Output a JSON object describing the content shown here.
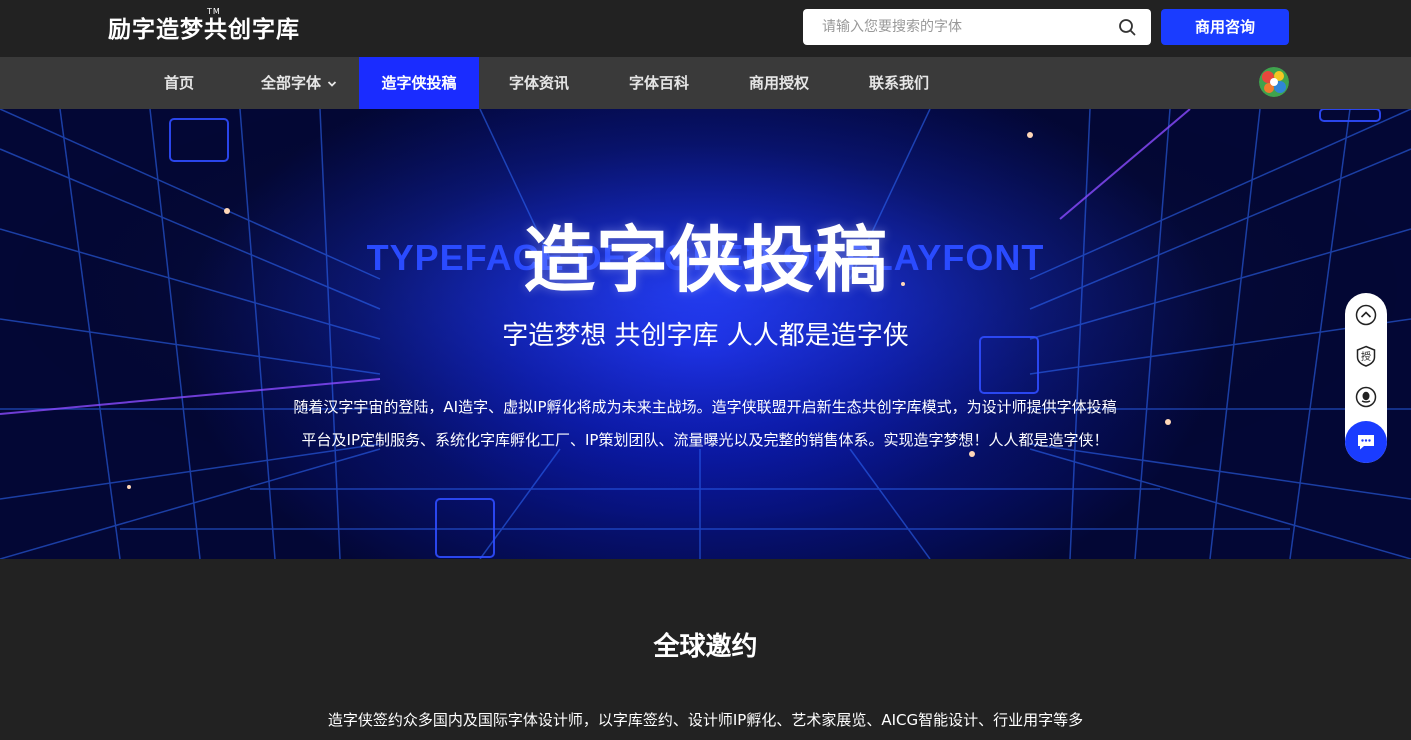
{
  "header": {
    "logo_text": "励字造梦共创字库",
    "logo_tm": "TM",
    "search_placeholder": "请输入您要搜索的字体",
    "consult_label": "商用咨询"
  },
  "nav": {
    "items": [
      {
        "label": "首页"
      },
      {
        "label": "全部字体"
      },
      {
        "label": "造字侠投稿"
      },
      {
        "label": "字体资讯"
      },
      {
        "label": "字体百科"
      },
      {
        "label": "商用授权"
      },
      {
        "label": "联系我们"
      }
    ],
    "active_index": 2
  },
  "hero": {
    "title": "造字侠投稿",
    "english": "TYPEFACE DESIGNER OF PLAYFONT",
    "subtitle": "字造梦想 共创字库 人人都是造字侠",
    "desc_line1": "随着汉字宇宙的登陆，AI造字、虚拟IP孵化将成为未来主战场。造字侠联盟开启新生态共创字库模式，为设计师提供字体投稿",
    "desc_line2": "平台及IP定制服务、系统化字库孵化工厂、IP策划团队、流量曝光以及完整的销售体系。实现造字梦想！人人都是造字侠！"
  },
  "side_tools": {
    "icons": [
      "chevron-up-icon",
      "auth-badge-icon",
      "qq-icon",
      "chat-icon"
    ],
    "auth_label": "授"
  },
  "section": {
    "title": "全球邀约",
    "desc": "造字侠签约众多国内及国际字体设计师，以字库签约、设计师IP孵化、艺术家展览、AICG智能设计、行业用字等多"
  },
  "colors": {
    "accent": "#1a3cff",
    "nav_active": "#1a2cff",
    "background": "#222222",
    "nav_bg": "#3a3a3a"
  }
}
